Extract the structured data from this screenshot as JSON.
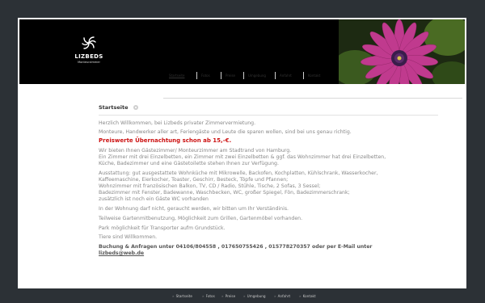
{
  "header": {
    "logo_title": "LIZBEDS",
    "logo_subtitle": "Monteurzimmer"
  },
  "nav": {
    "items": [
      {
        "label": "Startseite",
        "active": true
      },
      {
        "label": "Fotos"
      },
      {
        "label": "Preise"
      },
      {
        "label": "Umgebung"
      },
      {
        "label": "Anfahrt"
      },
      {
        "label": "Kontakt"
      }
    ]
  },
  "content": {
    "heading": "Startseite",
    "p1": "Herzlich Willkommen, bei Lizbeds privater Zimmervermietung.",
    "p2": "Monteure, Handwerker aller art, Feriengäste und Leute die sparen wollen, sind bei uns genau richtig.",
    "highlight": "Preiswerte Übernachtung schon ab 15,-€.",
    "p4_1": "Wir bieten Ihnen Gästezimmer/ Monteurzimmer am Stadtrand von Hamburg.",
    "p4_2": "Ein Zimmer mit drei Einzelbetten, ein Zimmer mit zwei Einzelbetten & ggf. das Wohnzimmer hat drei Einzelbetten,",
    "p4_3": "Küche, Badezimmer und eine Gästetoilette stehen Ihnen zur Verfügung.",
    "p5_1": "Ausstattung: gut ausgestattete Wohnküche mit Mikrowelle, Backofen, Kochplatten, Kühlschrank, Wasserkocher,",
    "p5_2": "Kaffeemaschine, Eierkocher, Toaster, Geschirr, Besteck, Töpfe und Pfannen;",
    "p5_3": "Wohnzimmer mit französischen Balkon, TV, CD / Radio, Stühle, Tische, 2 Sofas, 3 Sessel;",
    "p5_4": "Badezimmer mit Fenster, Badewanne, Waschbecken, WC, großer Spiegel, Fön, Badezimmerschrank;",
    "p5_5": "zusätzlich ist noch ein Gäste WC vorhanden",
    "p6": "In der Wohnung darf nicht, geraucht werden, wir bitten um Ihr Verständinis.",
    "p7": "Teilweise Gartenmitbenutzung, Möglichkeit zum Grillen, Gartenmöbel vorhanden.",
    "p8": "Park möglichkeit für Transporter aufm Grundstück.",
    "p9": "Tiere sind Willkommen.",
    "contact_line": "Buchung & Anfragen unter 04106/804558 , 017650755426 , 015778270357 oder per E-Mail unter",
    "email": "lizbeds@web.de"
  },
  "footer": {
    "items": [
      "Startseite",
      "Fotos",
      "Preise",
      "Umgebung",
      "Anfahrt",
      "Kontakt"
    ]
  },
  "colors": {
    "background": "#2c3136",
    "highlight": "#cc1111",
    "flower": "#c03a8e"
  }
}
